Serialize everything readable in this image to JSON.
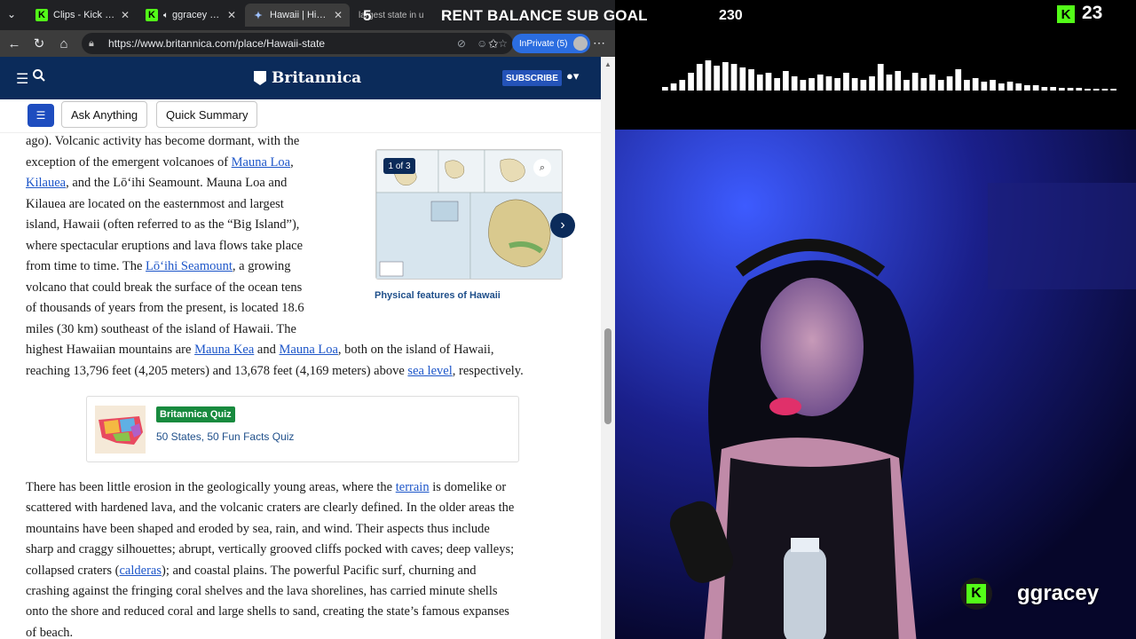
{
  "browser": {
    "tabs": [
      {
        "label": "Clips - Kick Dashb",
        "icon": "kick-icon",
        "active": false
      },
      {
        "label": "ggracey Strea",
        "icon": "kick-icon",
        "active": false
      },
      {
        "label": "Hawaii | History,",
        "icon": "britannica-icon",
        "active": true
      },
      {
        "label": "largest state in u",
        "icon": "search-icon",
        "active": false
      }
    ],
    "url": "https://www.britannica.com/place/Hawaii-state",
    "inprivate_label": "InPrivate (5)"
  },
  "britannica": {
    "logo_text": "Britannica",
    "subscribe_label": "SUBSCRIBE",
    "ask_label": "Ask Anything",
    "summary_label": "Quick Summary"
  },
  "article": {
    "lines": [
      {
        "parts": [
          {
            "t": "ago). Volcanic activity has become dormant, with the"
          }
        ]
      },
      {
        "parts": [
          {
            "t": "exception of the emergent volcanoes of "
          },
          {
            "t": "Mauna Loa",
            "link": true
          },
          {
            "t": ","
          }
        ]
      },
      {
        "parts": [
          {
            "t": "Kilauea",
            "link": true
          },
          {
            "t": ", and the Lōʻihi Seamount. Mauna Loa and"
          }
        ]
      },
      {
        "parts": [
          {
            "t": "Kilauea are located on the easternmost and largest"
          }
        ]
      },
      {
        "parts": [
          {
            "t": "island, Hawaii (often referred to as the “Big Island”),"
          }
        ]
      },
      {
        "parts": [
          {
            "t": "where spectacular eruptions and lava flows take place"
          }
        ]
      },
      {
        "parts": [
          {
            "t": "from time to time. The "
          },
          {
            "t": "Lōʻihi Seamount",
            "link": true
          },
          {
            "t": ", a growing"
          }
        ]
      },
      {
        "parts": [
          {
            "t": "volcano that could break the surface of the ocean tens"
          }
        ]
      },
      {
        "parts": [
          {
            "t": "of thousands of years from the present, is located 18.6"
          }
        ]
      },
      {
        "parts": [
          {
            "t": "miles (30 km) southeast of the island of Hawaii. The"
          }
        ]
      },
      {
        "parts": [
          {
            "t": "highest Hawaiian mountains are "
          },
          {
            "t": "Mauna Kea",
            "link": true
          },
          {
            "t": " and "
          },
          {
            "t": "Mauna Loa",
            "link": true
          },
          {
            "t": ", both on the island of Hawaii,"
          }
        ]
      },
      {
        "parts": [
          {
            "t": "reaching 13,796 feet (4,205 meters) and 13,678 feet (4,169 meters) above "
          },
          {
            "t": "sea level",
            "link": true
          },
          {
            "t": ", respectively."
          }
        ]
      }
    ],
    "lines2": [
      {
        "parts": [
          {
            "t": "There has been little erosion in the geologically young areas, where the "
          },
          {
            "t": "terrain",
            "link": true
          },
          {
            "t": " is domelike or"
          }
        ]
      },
      {
        "parts": [
          {
            "t": "scattered with hardened lava, and the volcanic craters are clearly defined. In the older areas the"
          }
        ]
      },
      {
        "parts": [
          {
            "t": "mountains have been shaped and eroded by sea, rain, and wind. Their aspects thus include"
          }
        ]
      },
      {
        "parts": [
          {
            "t": "sharp and craggy silhouettes; abrupt, vertically grooved cliffs pocked with caves; deep valleys;"
          }
        ]
      },
      {
        "parts": [
          {
            "t": "collapsed craters ("
          },
          {
            "t": "calderas",
            "link": true
          },
          {
            "t": "); and coastal plains. The powerful Pacific surf, churning and"
          }
        ]
      },
      {
        "parts": [
          {
            "t": "crashing against the fringing coral shelves and the lava shorelines, has carried minute shells"
          }
        ]
      },
      {
        "parts": [
          {
            "t": "onto the shore and reduced coral and large shells to sand, creating the state’s famous expanses"
          }
        ]
      },
      {
        "parts": [
          {
            "t": "of beach."
          }
        ]
      }
    ],
    "figure_badge": "1 of 3",
    "figure_caption": "Physical features of Hawaii",
    "quiz_badge": "Britannica Quiz",
    "quiz_title": "50 States, 50 Fun Facts Quiz"
  },
  "stream": {
    "goal_count_prefix": "5",
    "goal_text": "RENT BALANCE SUB GOAL",
    "goal_target": "230",
    "viewers": "23",
    "streamer_name": "ggracey",
    "brand_color": "#53fc18"
  }
}
